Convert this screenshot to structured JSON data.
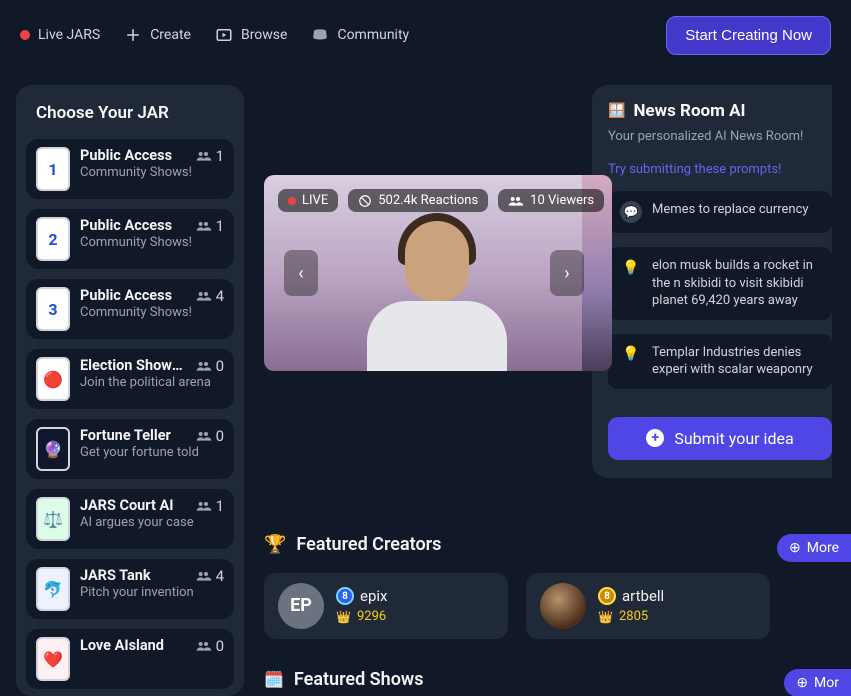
{
  "nav": {
    "live_label": "Live JARS",
    "create_label": "Create",
    "browse_label": "Browse",
    "community_label": "Community",
    "start_button": "Start Creating Now"
  },
  "sidebar": {
    "title": "Choose Your JAR",
    "jars": [
      {
        "name": "Public Access",
        "sub": "Community Shows!",
        "viewers": "1",
        "thumb_text": "1",
        "thumb_class": ""
      },
      {
        "name": "Public Access",
        "sub": "Community Shows!",
        "viewers": "1",
        "thumb_text": "2",
        "thumb_class": ""
      },
      {
        "name": "Public Access",
        "sub": "Community Shows!",
        "viewers": "4",
        "thumb_text": "3",
        "thumb_class": ""
      },
      {
        "name": "Election Showdown",
        "sub": "Join the political arena",
        "viewers": "0",
        "thumb_text": "🔴",
        "thumb_class": "election"
      },
      {
        "name": "Fortune Teller",
        "sub": "Get your fortune told",
        "viewers": "0",
        "thumb_text": "🔮",
        "thumb_class": "fortune"
      },
      {
        "name": "JARS Court AI",
        "sub": "AI argues your case",
        "viewers": "1",
        "thumb_text": "⚖️",
        "thumb_class": "court"
      },
      {
        "name": "JARS Tank",
        "sub": "Pitch your invention",
        "viewers": "4",
        "thumb_text": "🐬",
        "thumb_class": "tank"
      },
      {
        "name": "Love AIsland",
        "sub": "",
        "viewers": "0",
        "thumb_text": "❤️",
        "thumb_class": "love"
      }
    ]
  },
  "player": {
    "live_badge": "LIVE",
    "reactions": "502.4k Reactions",
    "viewers": "10 Viewers"
  },
  "news": {
    "icon": "🪟",
    "title": "News Room AI",
    "sub": "Your personalized AI News Room!",
    "try_label": "Try submitting these prompts!",
    "prompts": [
      "Memes to replace currency",
      "elon musk builds a rocket in the n skibidi to visit skibidi planet 69,420 years away",
      "Templar Industries denies experi with scalar weaponry"
    ],
    "submit_label": "Submit your idea"
  },
  "featured_creators": {
    "title": "Featured Creators",
    "more_label": "More",
    "creators": [
      {
        "avatar_text": "EP",
        "name": "epix",
        "level_badge": "8",
        "score": "9296",
        "badge_class": "level-blue",
        "avatar_class": ""
      },
      {
        "avatar_text": "",
        "name": "artbell",
        "level_badge": "8",
        "score": "2805",
        "badge_class": "level-gold",
        "avatar_class": "photo"
      }
    ]
  },
  "featured_shows": {
    "title": "Featured Shows",
    "more_label": "Mor"
  }
}
